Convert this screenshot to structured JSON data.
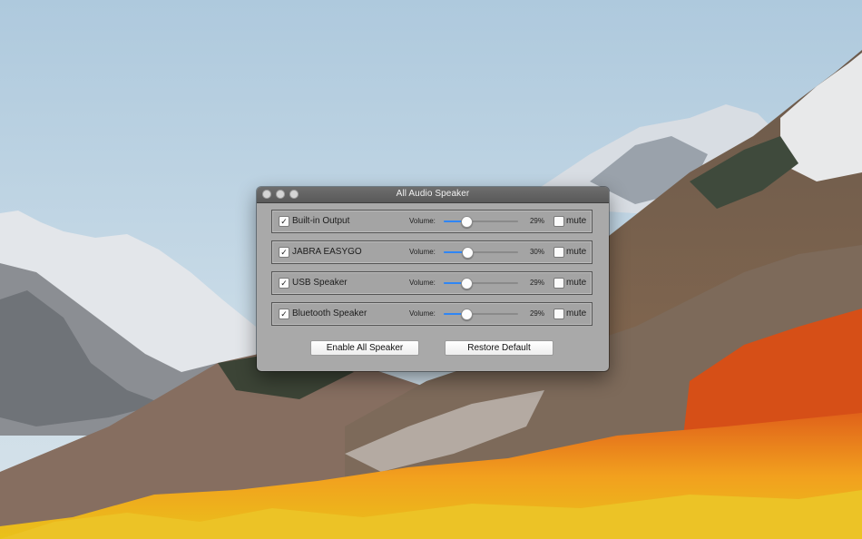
{
  "window": {
    "title": "All Audio Speaker"
  },
  "devices": [
    {
      "name": "Built-in Output",
      "enabled": true,
      "volume_label": "Volume:",
      "volume": 29,
      "volume_text": "29%",
      "mute_label": "mute",
      "muted": false
    },
    {
      "name": "JABRA EASYGO",
      "enabled": true,
      "volume_label": "Volume:",
      "volume": 30,
      "volume_text": "30%",
      "mute_label": "mute",
      "muted": false
    },
    {
      "name": "USB Speaker",
      "enabled": true,
      "volume_label": "Volume:",
      "volume": 29,
      "volume_text": "29%",
      "mute_label": "mute",
      "muted": false
    },
    {
      "name": "Bluetooth Speaker",
      "enabled": true,
      "volume_label": "Volume:",
      "volume": 29,
      "volume_text": "29%",
      "mute_label": "mute",
      "muted": false
    }
  ],
  "buttons": {
    "enable_all": "Enable All Speaker",
    "restore_default": "Restore Default"
  },
  "colors": {
    "slider_accent": "#2f86f5",
    "window_background": "#a9a9a9"
  },
  "icons": {
    "check": "✓"
  }
}
